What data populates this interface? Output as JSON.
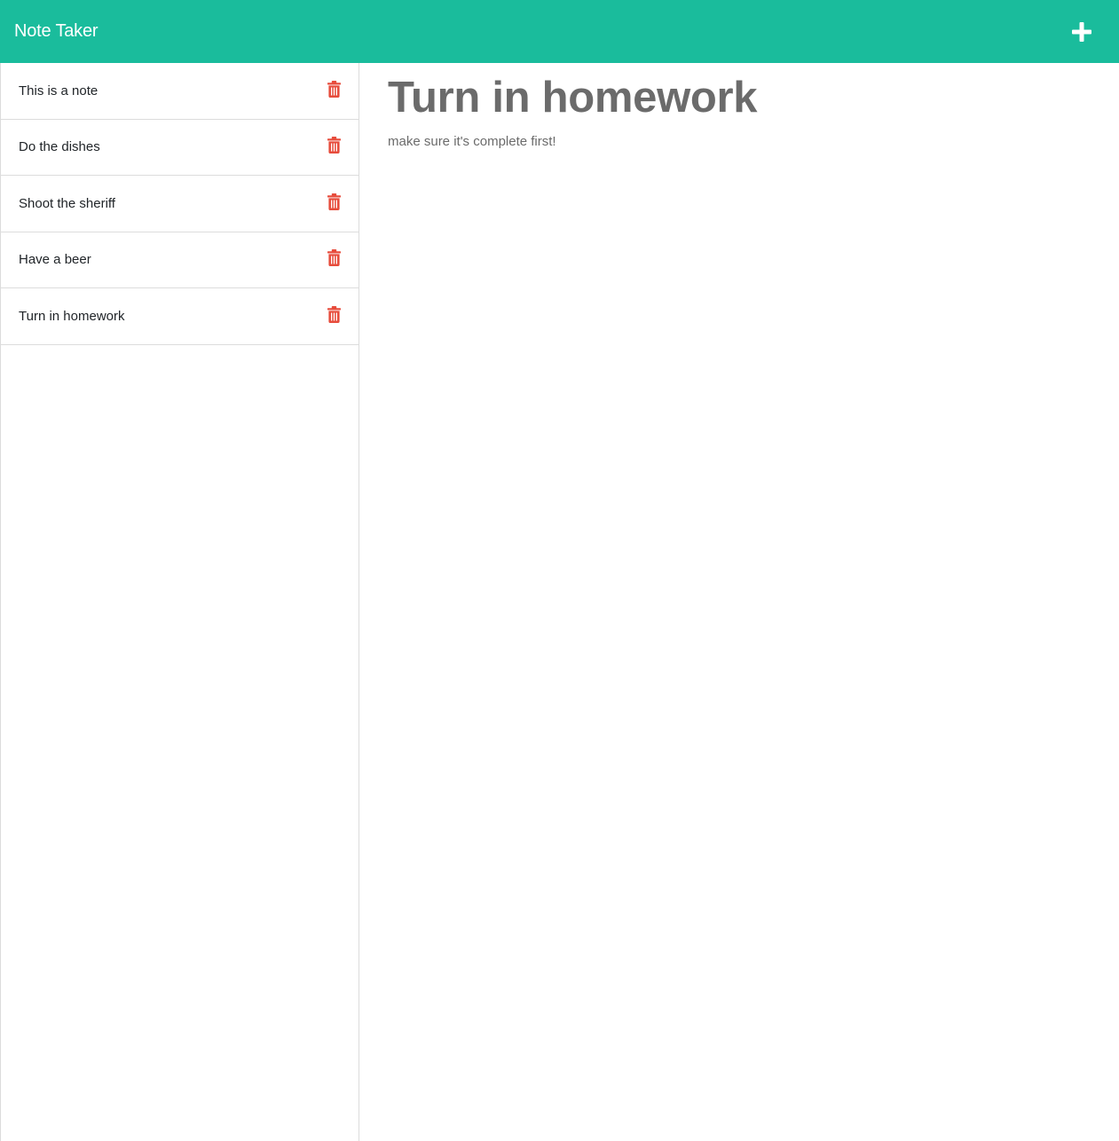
{
  "app": {
    "title": "Note Taker",
    "accent_color": "#1abc9c",
    "delete_color": "#e74c3c",
    "add_icon": "plus-icon"
  },
  "sidebar": {
    "notes": [
      {
        "title": "This is a note",
        "icon": "trash-icon"
      },
      {
        "title": "Do the dishes",
        "icon": "trash-icon"
      },
      {
        "title": "Shoot the sheriff",
        "icon": "trash-icon"
      },
      {
        "title": "Have a beer",
        "icon": "trash-icon"
      },
      {
        "title": "Turn in homework",
        "icon": "trash-icon"
      }
    ]
  },
  "main": {
    "note_title": "Turn in homework",
    "note_text": "make sure it's complete first!"
  }
}
